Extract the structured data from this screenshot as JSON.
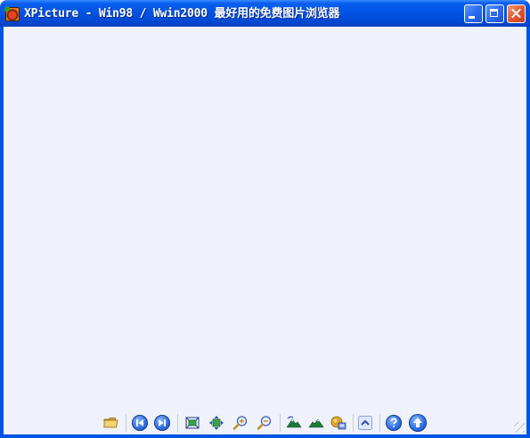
{
  "window": {
    "title": "XPicture - Win98 / Wwin2000 最好用的免费图片浏览器"
  },
  "toolbar": {
    "buttons": [
      {
        "name": "open-folder",
        "icon": "folder-open-icon"
      },
      {
        "name": "previous-image",
        "icon": "skip-previous-icon"
      },
      {
        "name": "next-image",
        "icon": "skip-next-icon"
      },
      {
        "name": "fit-to-window",
        "icon": "fit-window-icon"
      },
      {
        "name": "actual-size",
        "icon": "move-arrows-icon"
      },
      {
        "name": "zoom-in",
        "icon": "zoom-in-icon"
      },
      {
        "name": "zoom-out",
        "icon": "zoom-out-icon"
      },
      {
        "name": "rotate-left",
        "icon": "rotate-left-icon"
      },
      {
        "name": "rotate-right",
        "icon": "rotate-right-icon"
      },
      {
        "name": "set-wallpaper",
        "icon": "wallpaper-icon"
      },
      {
        "name": "collapse",
        "icon": "chevron-up-icon"
      },
      {
        "name": "help",
        "icon": "help-icon"
      },
      {
        "name": "check-update",
        "icon": "up-arrow-icon"
      }
    ]
  },
  "colors": {
    "titlebar": "#0054e3",
    "client_background": "#f0f2fb",
    "close_button": "#e35a30"
  }
}
